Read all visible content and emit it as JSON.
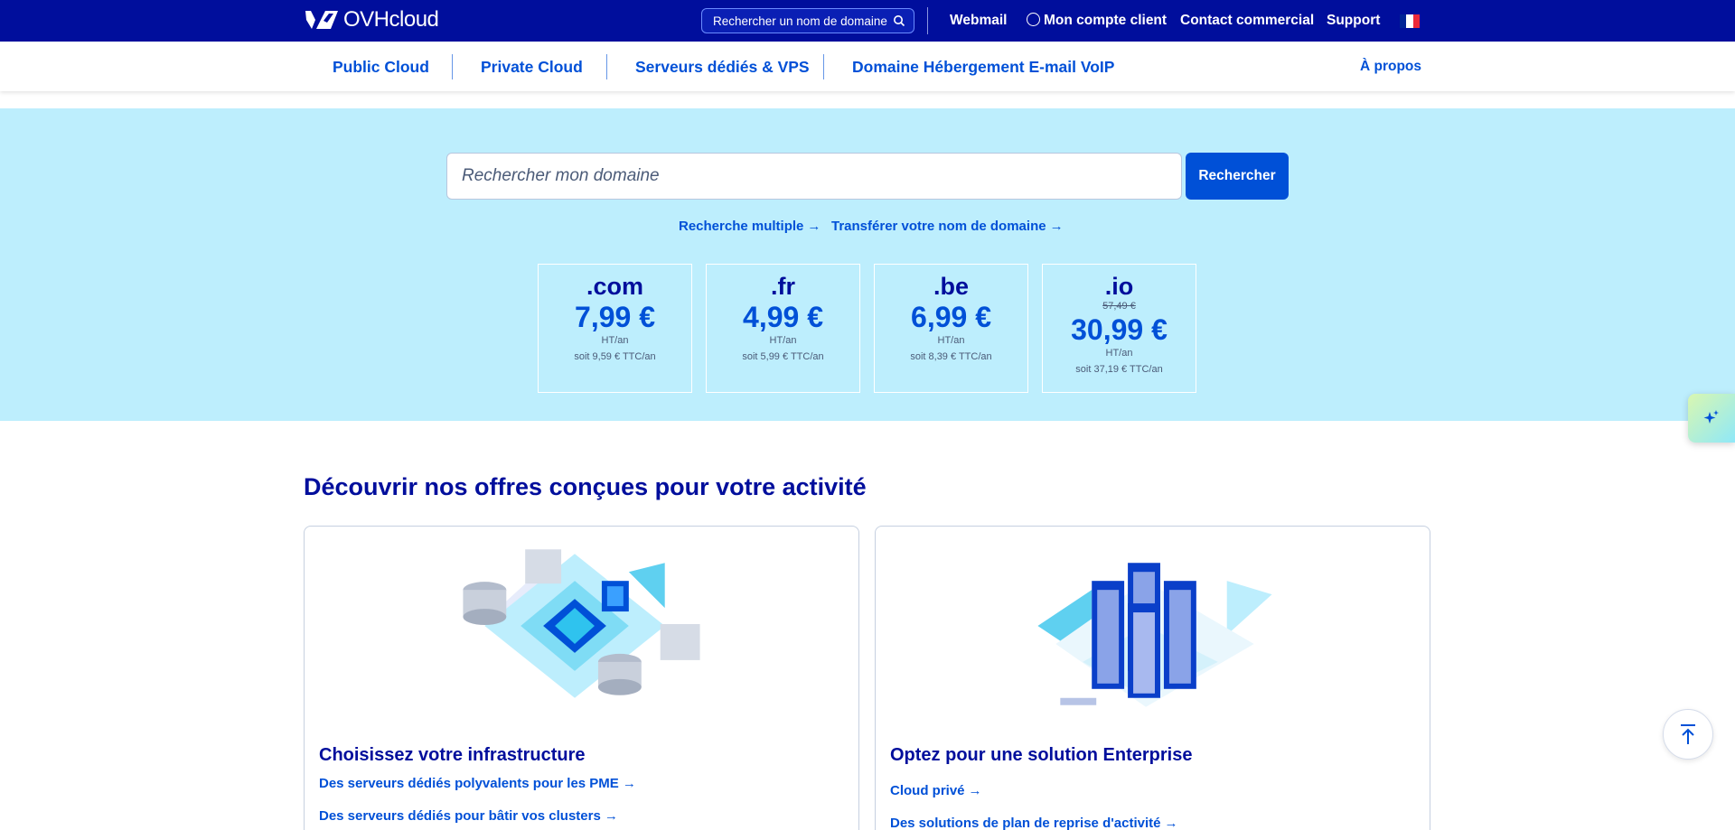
{
  "header": {
    "brand": "OVHcloud",
    "search_label": "Rechercher un nom de domaine",
    "links": {
      "webmail": "Webmail",
      "account": "Mon compte client",
      "contact": "Contact commercial",
      "support": "Support"
    },
    "flag_colors": [
      "#002395",
      "#ffffff",
      "#ed2939"
    ]
  },
  "nav": {
    "items": [
      "Public Cloud",
      "Private Cloud",
      "Serveurs dédiés & VPS",
      "Domaine Hébergement E-mail VoIP"
    ],
    "about": "À propos"
  },
  "hero": {
    "search_placeholder": "Rechercher mon domaine",
    "search_button": "Rechercher",
    "links": {
      "multi": "Recherche multiple",
      "transfer": "Transférer votre nom de domaine"
    },
    "tlds": [
      {
        "name": ".com",
        "old_price": "",
        "price": "7,99 €",
        "unit": "HT/an",
        "ttc": "soit 9,59 € TTC/an"
      },
      {
        "name": ".fr",
        "old_price": "",
        "price": "4,99 €",
        "unit": "HT/an",
        "ttc": "soit 5,99 € TTC/an"
      },
      {
        "name": ".be",
        "old_price": "",
        "price": "6,99 €",
        "unit": "HT/an",
        "ttc": "soit 8,39 € TTC/an"
      },
      {
        "name": ".io",
        "old_price": "57,49 €",
        "price": "30,99 €",
        "unit": "HT/an",
        "ttc": "soit 37,19 € TTC/an"
      }
    ]
  },
  "offers": {
    "title": "Découvrir nos offres conçues pour votre activité",
    "cards": [
      {
        "title": "Choisissez votre infrastructure",
        "links": [
          "Des serveurs dédiés polyvalents pour les PME",
          "Des serveurs dédiés pour bâtir vos clusters"
        ]
      },
      {
        "title": "Optez pour une solution Enterprise",
        "links": [
          "Cloud privé",
          "Des solutions de plan de reprise d'activité"
        ]
      }
    ]
  },
  "colors": {
    "brand_navy": "#000e9c",
    "accent_blue": "#0050d7",
    "hero_bg": "#bdeefd"
  }
}
